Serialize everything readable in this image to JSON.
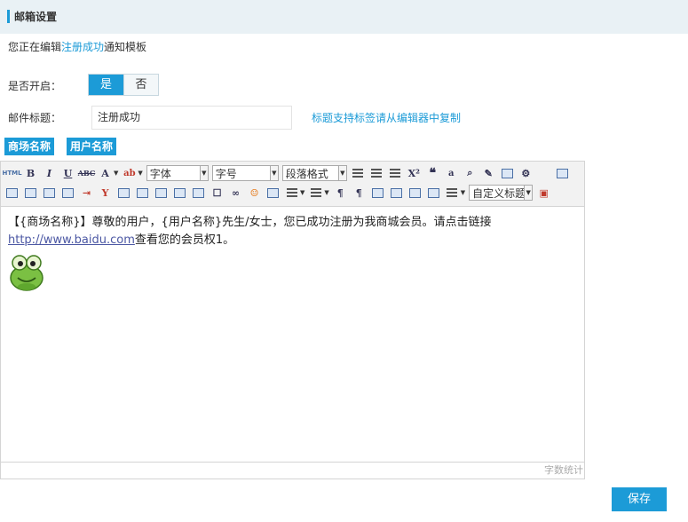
{
  "header": {
    "title": "邮箱设置"
  },
  "editing": {
    "prefix": "您正在编辑",
    "template_name": "注册成功",
    "suffix": "通知模板"
  },
  "enable": {
    "label": "是否开启：",
    "yes": "是",
    "no": "否",
    "selected": "是"
  },
  "subject": {
    "label": "邮件标题：",
    "value": "注册成功",
    "tip": "标题支持标签请从编辑器中复制"
  },
  "tags": [
    "商场名称",
    "用户名称"
  ],
  "toolbar": {
    "font_family": "字体",
    "font_size": "字号",
    "paragraph": "段落格式",
    "custom_title": "自定义标题",
    "html_label": "HTML"
  },
  "content": {
    "line1": "【{商场名称}】尊敬的用户，{用户名称}先生/女士，您已成功注册为我商城会员。请点击链接",
    "url": "http://www.baidu.com",
    "line2_suffix": "查看您的会员权1。"
  },
  "statusbar": {
    "word_count": "字数统计"
  },
  "save_label": "保存",
  "colors": {
    "accent": "#1c9bd7",
    "header_bg": "#e9f1f5"
  }
}
